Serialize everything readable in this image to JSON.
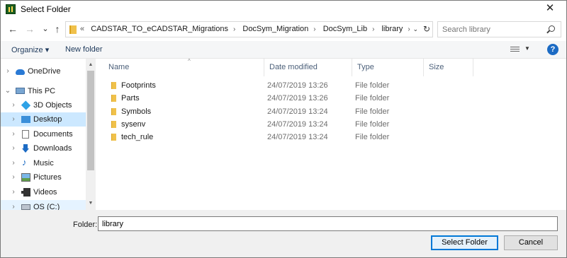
{
  "window": {
    "title": "Select Folder",
    "close_glyph": "✕"
  },
  "nav": {
    "back": "←",
    "forward": "→",
    "recent": "⌄",
    "up": "↑"
  },
  "address": {
    "lead": "«",
    "crumbs": [
      "CADSTAR_TO_eCADSTAR_Migrations",
      "DocSym_Migration",
      "DocSym_Lib",
      "library"
    ],
    "separator": "›",
    "dropdown_glyph": "⌄",
    "refresh_glyph": "↻"
  },
  "search": {
    "placeholder": "Search library"
  },
  "toolbar": {
    "organize_label": "Organize ▾",
    "new_folder_label": "New folder",
    "help_glyph": "?"
  },
  "sidebar": {
    "items": [
      {
        "label": "OneDrive",
        "chevron": "›",
        "icon": "cloud-icon"
      },
      {
        "label": "This PC",
        "chevron": "⌄",
        "icon": "computer-icon"
      },
      {
        "label": "3D Objects",
        "chevron": "›",
        "icon": "cube-icon"
      },
      {
        "label": "Desktop",
        "chevron": "›",
        "icon": "desktop-icon"
      },
      {
        "label": "Documents",
        "chevron": "›",
        "icon": "document-icon"
      },
      {
        "label": "Downloads",
        "chevron": "›",
        "icon": "download-icon"
      },
      {
        "label": "Music",
        "chevron": "›",
        "icon": "music-icon",
        "glyph": "♪"
      },
      {
        "label": "Pictures",
        "chevron": "›",
        "icon": "picture-icon"
      },
      {
        "label": "Videos",
        "chevron": "›",
        "icon": "video-icon"
      },
      {
        "label": "OS (C:)",
        "chevron": "›",
        "icon": "drive-icon"
      }
    ],
    "scroll_up": "▲",
    "scroll_down": "▼"
  },
  "files": {
    "sort_caret": "^",
    "columns": [
      "Name",
      "Date modified",
      "Type",
      "Size"
    ],
    "rows": [
      {
        "name": "Footprints",
        "date": "24/07/2019 13:26",
        "type": "File folder"
      },
      {
        "name": "Parts",
        "date": "24/07/2019 13:26",
        "type": "File folder"
      },
      {
        "name": "Symbols",
        "date": "24/07/2019 13:24",
        "type": "File folder"
      },
      {
        "name": "sysenv",
        "date": "24/07/2019 13:24",
        "type": "File folder"
      },
      {
        "name": "tech_rule",
        "date": "24/07/2019 13:24",
        "type": "File folder"
      }
    ]
  },
  "footer": {
    "folder_label": "Folder:",
    "folder_value": "library",
    "select_label": "Select Folder",
    "cancel_label": "Cancel"
  }
}
